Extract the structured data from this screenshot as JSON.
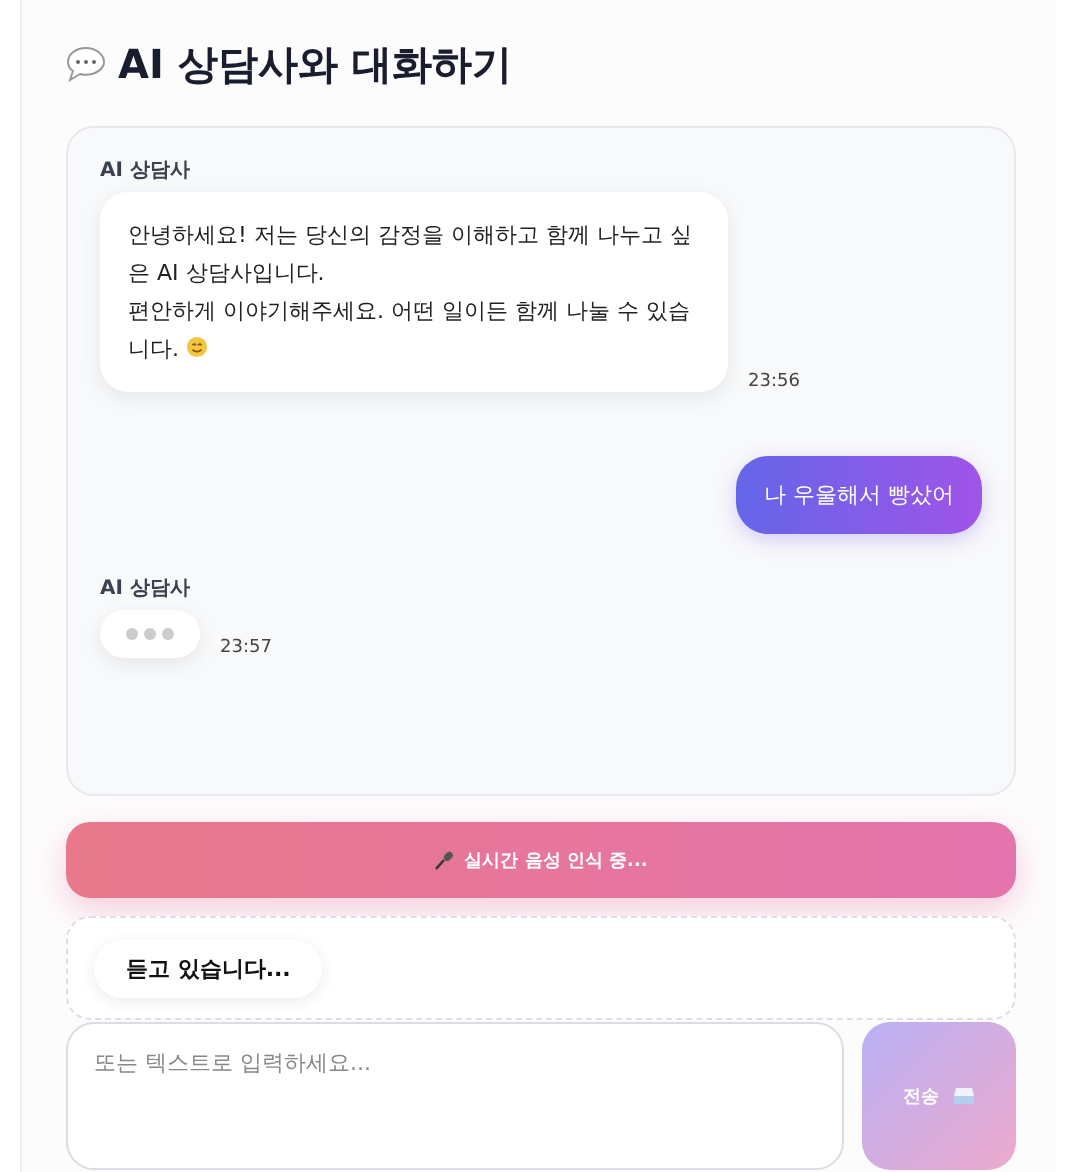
{
  "title": "AI 상담사와 대화하기",
  "messages": [
    {
      "kind": "bot",
      "sender": "AI 상담사",
      "lines": [
        "안녕하세요! 저는 당신의 감정을 이해하고 함께 나누고 싶은 AI 상담사입니다.",
        "편안하게 이야기해주세요. 어떤 일이든 함께 나눌 수 있습니다."
      ],
      "time": "23:56"
    },
    {
      "kind": "user",
      "text": "나 우울해서 빵샀어"
    },
    {
      "kind": "typing",
      "sender": "AI 상담사",
      "time": "23:57"
    }
  ],
  "voice_bar": {
    "label": "실시간 음성 인식 중...",
    "active": true
  },
  "status": {
    "text": "듣고 있습니다..."
  },
  "input": {
    "placeholder": "또는 텍스트로 입력하세요..."
  },
  "send_button": {
    "label": "전송",
    "disabled": true
  }
}
